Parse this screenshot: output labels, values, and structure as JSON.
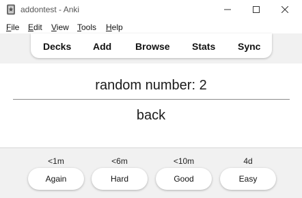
{
  "window": {
    "title": "addontest - Anki",
    "icon": "anki-app-icon",
    "controls": [
      "minimize-icon",
      "maximize-icon",
      "close-icon"
    ]
  },
  "menu": [
    {
      "key": "F",
      "rest": "ile"
    },
    {
      "key": "E",
      "rest": "dit"
    },
    {
      "key": "V",
      "rest": "iew"
    },
    {
      "key": "T",
      "rest": "ools"
    },
    {
      "key": "H",
      "rest": "elp"
    }
  ],
  "toolbar": {
    "decks": "Decks",
    "add": "Add",
    "browse": "Browse",
    "stats": "Stats",
    "sync": "Sync"
  },
  "card": {
    "front": "random number: 2",
    "back": "back"
  },
  "answers": [
    {
      "interval": "<1m",
      "label": "Again"
    },
    {
      "interval": "<6m",
      "label": "Hard"
    },
    {
      "interval": "<10m",
      "label": "Good"
    },
    {
      "interval": "4d",
      "label": "Easy"
    }
  ],
  "colors": {
    "bar_background": "#f1f1f1",
    "card_background": "#ffffff",
    "button_background": "#ffffff"
  }
}
